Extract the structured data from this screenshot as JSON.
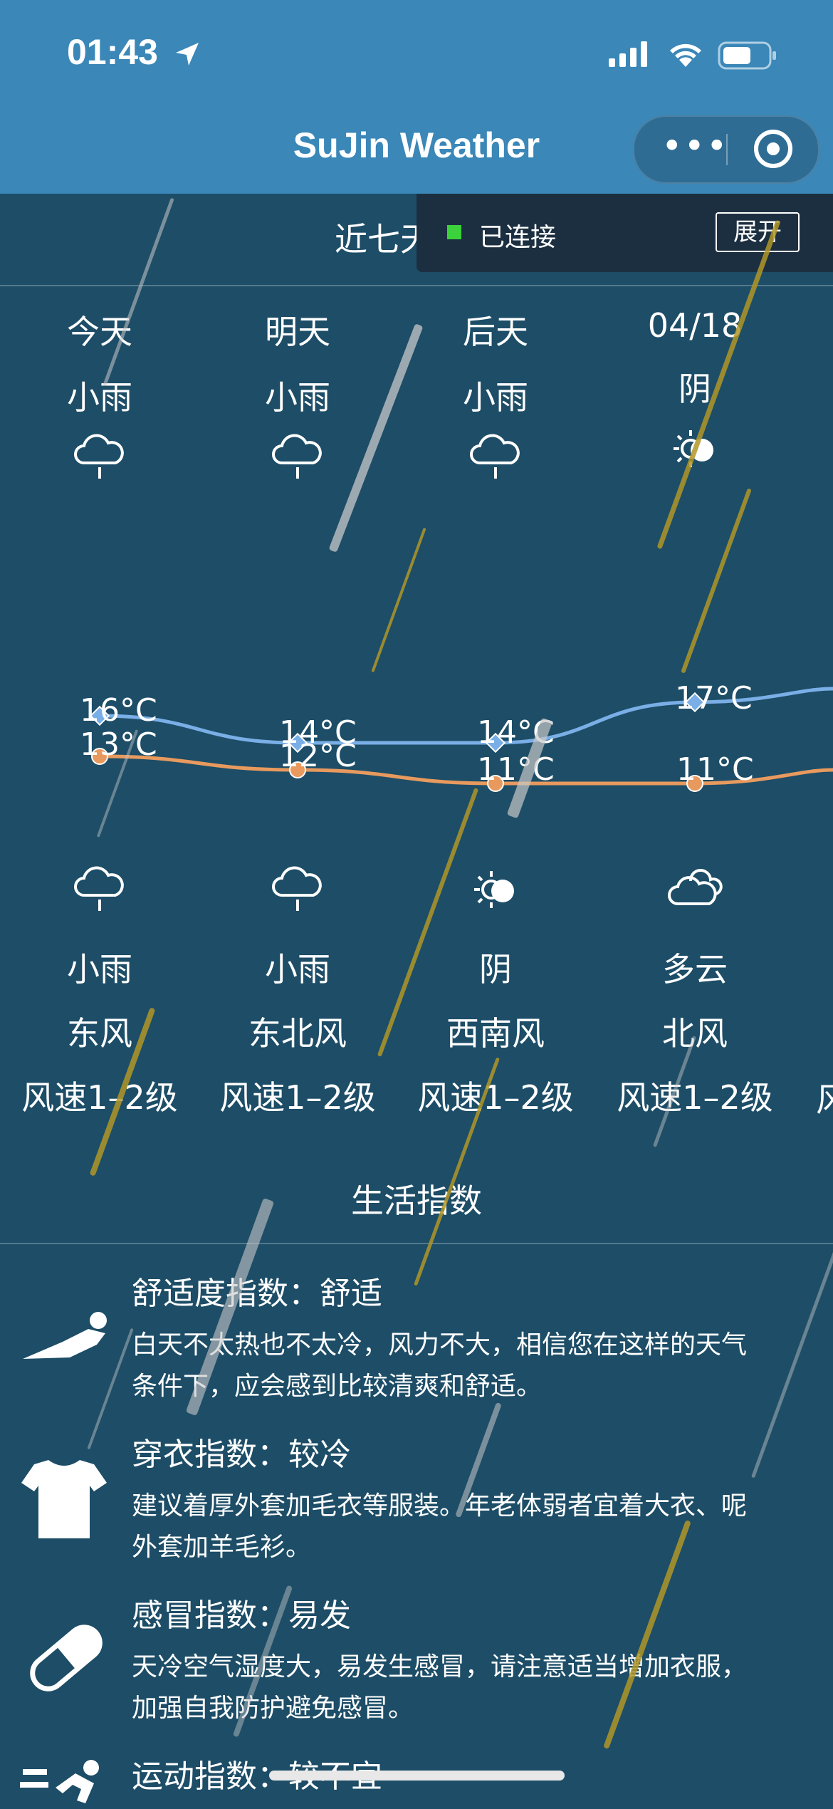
{
  "status": {
    "time": "01:43"
  },
  "nav": {
    "title": "SuJin Weather",
    "more": "•••"
  },
  "forecast": {
    "title": "近七天预报",
    "connection": "已连接",
    "expand": "展开",
    "days": [
      {
        "label": "今天",
        "day_weather": "小雨",
        "day_icon": "rain-cloud-icon",
        "high": "16°C",
        "low": "13°C",
        "night_icon": "rain-cloud-icon",
        "night_weather": "小雨",
        "wind": "东风",
        "wind_speed": "风速1–2级"
      },
      {
        "label": "明天",
        "day_weather": "小雨",
        "day_icon": "rain-cloud-icon",
        "high": "14°C",
        "low": "12°C",
        "night_icon": "rain-cloud-icon",
        "night_weather": "小雨",
        "wind": "东北风",
        "wind_speed": "风速1–2级"
      },
      {
        "label": "后天",
        "day_weather": "小雨",
        "day_icon": "rain-cloud-icon",
        "high": "14°C",
        "low": "11°C",
        "night_icon": "sun-cloud-icon",
        "night_weather": "阴",
        "wind": "西南风",
        "wind_speed": "风速1–2级"
      },
      {
        "label": "04/18",
        "day_weather": "阴",
        "day_icon": "sun-cloud-icon",
        "high": "17°C",
        "low": "11°C",
        "night_icon": "cloudy-icon",
        "night_weather": "多云",
        "wind": "北风",
        "wind_speed": "风速1–2级"
      }
    ],
    "partial_next": "风"
  },
  "chart_data": {
    "type": "line",
    "categories": [
      "今天",
      "明天",
      "后天",
      "04/18"
    ],
    "series": [
      {
        "values": [
          16,
          14,
          14,
          17
        ],
        "color": "#7aaee6"
      },
      {
        "values": [
          13,
          12,
          11,
          11
        ],
        "color": "#e89a5e"
      }
    ]
  },
  "life": {
    "title": "生活指数",
    "items": [
      {
        "icon": "lounging-person-icon",
        "title": "舒适度指数：舒适",
        "desc1": "白天不太热也不太冷，风力不大，相信您在这样的天气",
        "desc2": "条件下，应会感到比较清爽和舒适。"
      },
      {
        "icon": "tshirt-icon",
        "title": "穿衣指数：较冷",
        "desc1": "建议着厚外套加毛衣等服装。年老体弱者宜着大衣、呢",
        "desc2": "外套加羊毛衫。"
      },
      {
        "icon": "pill-icon",
        "title": "感冒指数：易发",
        "desc1": "天冷空气湿度大，易发生感冒，请注意适当增加衣服，",
        "desc2": "加强自我防护避免感冒。"
      },
      {
        "icon": "running-person-icon",
        "title": "运动指数：较不宜",
        "desc1": "",
        "desc2": ""
      }
    ]
  }
}
